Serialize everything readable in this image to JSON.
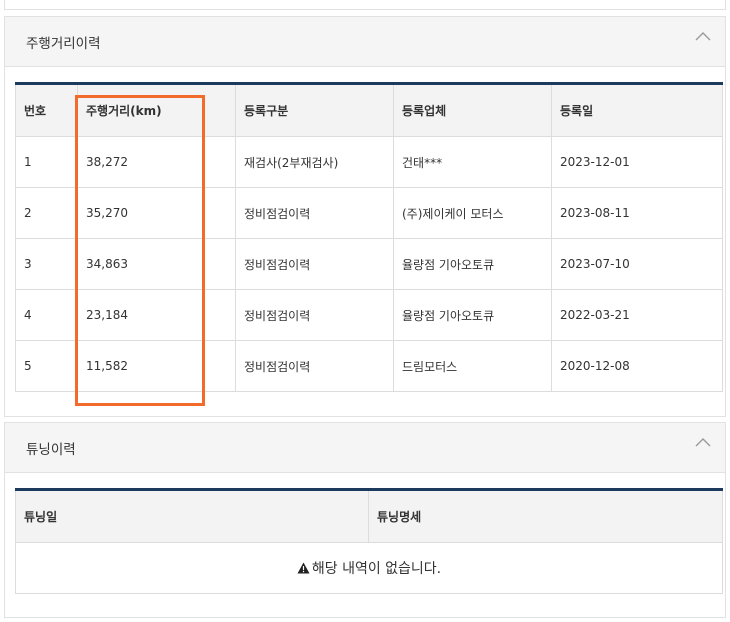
{
  "mileage_panel": {
    "title": "주행거리이력",
    "columns": [
      "번호",
      "주행거리(km)",
      "등록구분",
      "등록업체",
      "등록일"
    ],
    "rows": [
      {
        "no": "1",
        "mileage": "38,272",
        "type": "재검사(2부재검사)",
        "company": "건태***",
        "date": "2023-12-01"
      },
      {
        "no": "2",
        "mileage": "35,270",
        "type": "정비점검이력",
        "company": "(주)제이케이 모터스",
        "date": "2023-08-11"
      },
      {
        "no": "3",
        "mileage": "34,863",
        "type": "정비점검이력",
        "company": "율량점 기아오토큐",
        "date": "2023-07-10"
      },
      {
        "no": "4",
        "mileage": "23,184",
        "type": "정비점검이력",
        "company": "율량점 기아오토큐",
        "date": "2022-03-21"
      },
      {
        "no": "5",
        "mileage": "11,582",
        "type": "정비점검이력",
        "company": "드림모터스",
        "date": "2020-12-08"
      }
    ]
  },
  "tuning_panel": {
    "title": "튜닝이력",
    "columns": [
      "튜닝일",
      "튜닝명세"
    ],
    "empty_message": "해당 내역이 없습니다."
  },
  "icons": {
    "collapse": "chevron-up-icon",
    "warning": "warning-icon"
  },
  "colors": {
    "table_top_border": "#1c3a5e",
    "highlight": "#f26b2a"
  }
}
